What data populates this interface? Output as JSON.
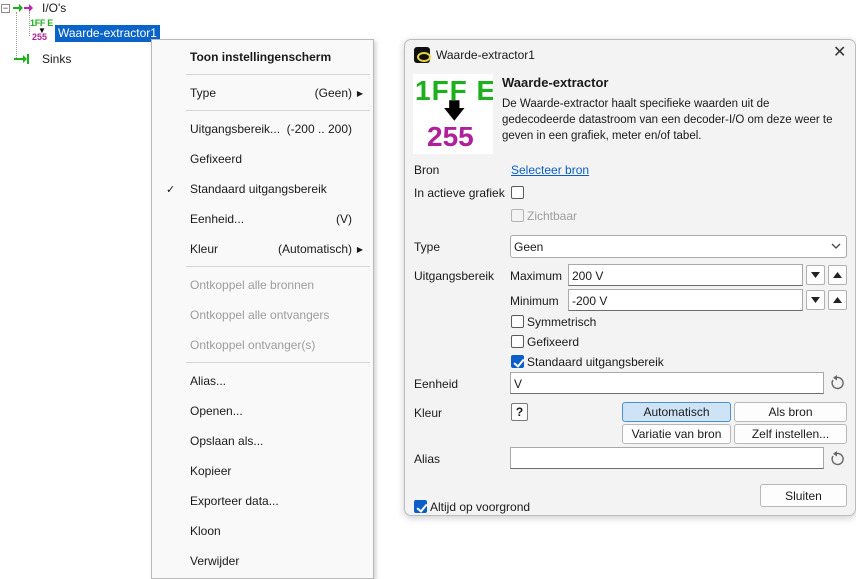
{
  "tree": {
    "ios_label": "I/O's",
    "selected_label": "Waarde-extractor1",
    "sinks_label": "Sinks",
    "mini_icon_top": "1FF E",
    "mini_icon_bottom": "255"
  },
  "context_menu": {
    "items": [
      {
        "label": "Toon instellingenscherm",
        "value": ""
      },
      {
        "label": "Type",
        "value": "(Geen)"
      },
      {
        "label": "Uitgangsbereik...",
        "value": "(-200 .. 200)"
      },
      {
        "label": "Gefixeerd",
        "value": ""
      },
      {
        "label": "Standaard uitgangsbereik",
        "value": ""
      },
      {
        "label": "Eenheid...",
        "value": "(V)"
      },
      {
        "label": "Kleur",
        "value": "(Automatisch)"
      },
      {
        "label": "Ontkoppel alle bronnen",
        "value": ""
      },
      {
        "label": "Ontkoppel alle ontvangers",
        "value": ""
      },
      {
        "label": "Ontkoppel ontvanger(s)",
        "value": ""
      },
      {
        "label": "Alias...",
        "value": ""
      },
      {
        "label": "Openen...",
        "value": ""
      },
      {
        "label": "Opslaan als...",
        "value": ""
      },
      {
        "label": "Kopieer",
        "value": ""
      },
      {
        "label": "Exporteer data...",
        "value": ""
      },
      {
        "label": "Kloon",
        "value": ""
      },
      {
        "label": "Verwijder",
        "value": ""
      }
    ],
    "check_glyph": "✓"
  },
  "dialog": {
    "title": "Waarde-extractor1",
    "heading": "Waarde-extractor",
    "description": "De Waarde-extractor haalt specifieke waarden uit de gedecodeerde datastroom van een decoder-I/O om deze weer te geven in een grafiek, meter en/of tabel.",
    "icon_top": "1FF E",
    "icon_bottom": "255",
    "bron_label": "Bron",
    "bron_link": "Selecteer bron",
    "active_graph_label": "In actieve grafiek",
    "zichtbaar_label": "Zichtbaar",
    "type_label": "Type",
    "type_value": "Geen",
    "range_label": "Uitgangsbereik",
    "maximum_label": "Maximum",
    "maximum_value": "200 V",
    "minimum_label": "Minimum",
    "minimum_value": "-200 V",
    "symmetrisch_label": "Symmetrisch",
    "gefixeerd_label": "Gefixeerd",
    "standaard_label": "Standaard uitgangsbereik",
    "eenheid_label": "Eenheid",
    "eenheid_value": "V",
    "kleur_label": "Kleur",
    "help_label": "?",
    "color_buttons": {
      "automatisch": "Automatisch",
      "als_bron": "Als bron",
      "variatie": "Variatie van bron",
      "zelf": "Zelf instellen..."
    },
    "alias_label": "Alias",
    "alias_value": "",
    "always_on_top_label": "Altijd op voorgrond",
    "close_button": "Sluiten",
    "close_glyph": "✕"
  }
}
